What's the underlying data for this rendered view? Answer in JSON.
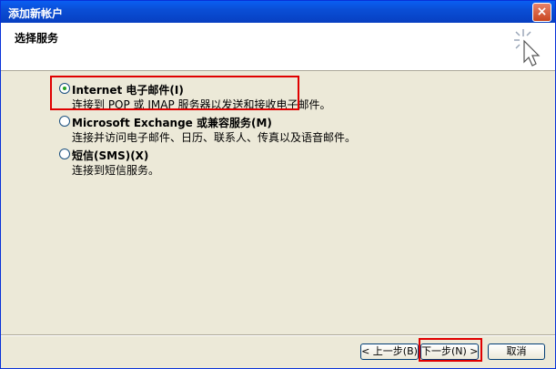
{
  "window": {
    "title": "添加新帐户",
    "close_label": "×"
  },
  "header": {
    "title": "选择服务"
  },
  "options": [
    {
      "label": "Internet 电子邮件(I)",
      "description": "连接到 POP 或 IMAP 服务器以发送和接收电子邮件。",
      "checked": true
    },
    {
      "label": "Microsoft Exchange 或兼容服务(M)",
      "description": "连接并访问电子邮件、日历、联系人、传真以及语音邮件。",
      "checked": false
    },
    {
      "label": "短信(SMS)(X)",
      "description": "连接到短信服务。",
      "checked": false
    }
  ],
  "buttons": {
    "back": "< 上一步(B)",
    "next": "下一步(N) >",
    "cancel": "取消"
  },
  "colors": {
    "title_bar": "#0a4ed6",
    "highlight": "#e00000",
    "radio_dot": "#21a121"
  }
}
